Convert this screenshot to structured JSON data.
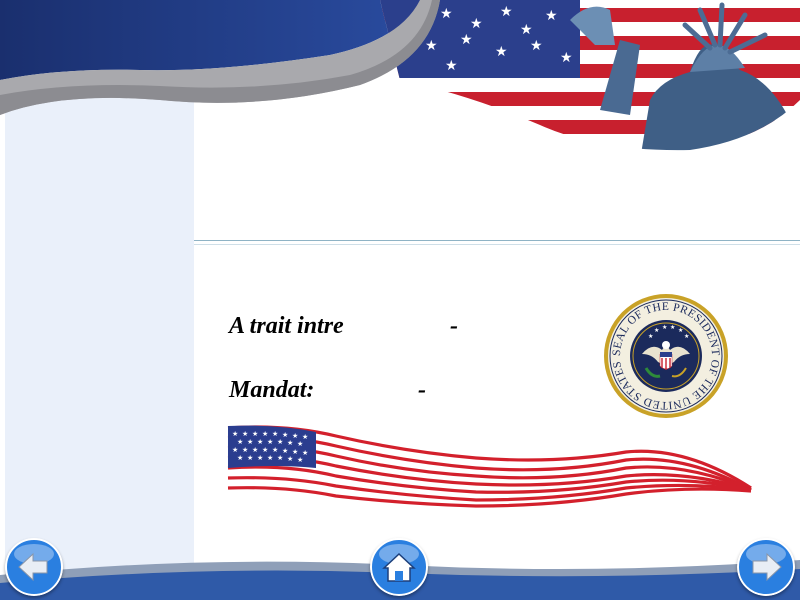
{
  "slide": {
    "field1_label": "A trait intre",
    "field1_value": "-",
    "field2_label": "Mandat:",
    "field2_value": "-"
  },
  "seal": {
    "text": "SEAL OF THE PRESIDENT OF THE UNITED STATES"
  },
  "nav": {
    "prev_icon": "arrow-left-icon",
    "home_icon": "home-icon",
    "next_icon": "arrow-right-icon"
  },
  "colors": {
    "header_blue": "#1e3f86",
    "flag_red": "#d3202c",
    "flag_blue": "#2b3d8f",
    "seal_gold": "#c9a227",
    "seal_navy": "#1b2a5c",
    "button_blue": "#2a7fe0",
    "sidebar": "#eaf0fa"
  }
}
